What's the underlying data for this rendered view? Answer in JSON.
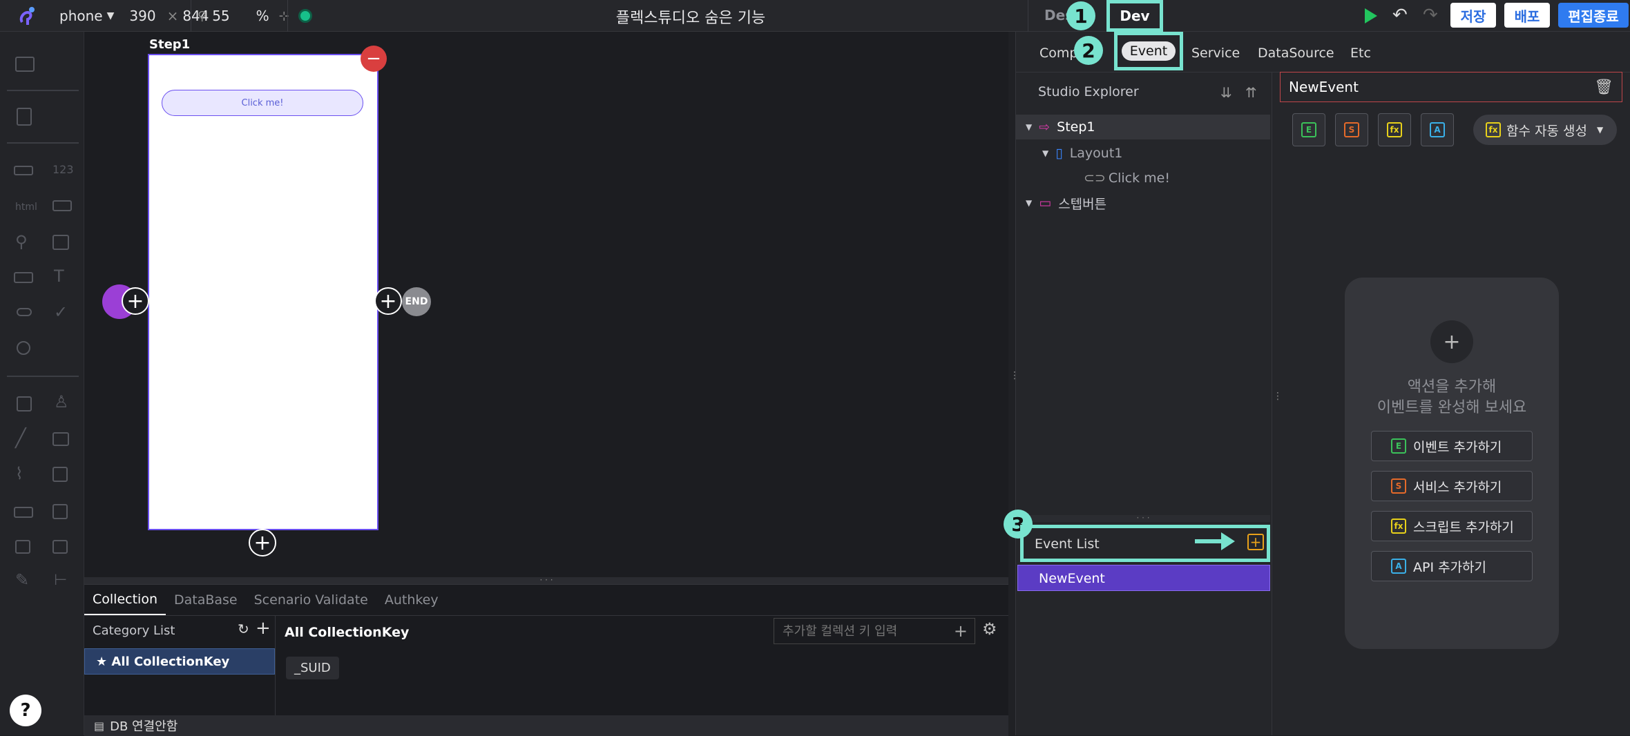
{
  "topbar": {
    "device": "phone",
    "width": "390",
    "height_prefix": "×",
    "height": "844",
    "zoom": "55",
    "zoom_unit": "%",
    "title": "플렉스튜디오 숨은 기능",
    "mode_design": "Des",
    "mode_dev": "Dev",
    "save_label": "저장",
    "deploy_label": "배포",
    "exit_label": "편집종료"
  },
  "callouts": {
    "one": "1",
    "two": "2",
    "three": "3"
  },
  "canvas": {
    "step_label": "Step1",
    "button_text": "Click me!",
    "end_label": "END",
    "minus": "−",
    "plus": "+"
  },
  "bottom": {
    "tabs": [
      "Collection",
      "DataBase",
      "Scenario Validate",
      "Authkey"
    ],
    "category_list": "Category List",
    "all_key_item": "★ All CollectionKey",
    "all_key_title": "All CollectionKey",
    "search_placeholder": "추가할 컬렉션 키 입력",
    "suid_chip": "_SUID",
    "db_status": "DB 연결안함"
  },
  "right": {
    "tabs": [
      "Comp",
      "Event",
      "Service",
      "DataSource",
      "Etc"
    ],
    "explorer_title": "Studio Explorer",
    "tree": {
      "step": "Step1",
      "layout": "Layout1",
      "button": "Click me!",
      "folder": "스텝버튼"
    },
    "event_list_title": "Event List",
    "event_item": "NewEvent",
    "event_name_value": "NewEvent",
    "tag_labels": {
      "event": "E",
      "service": "S",
      "script": "fx",
      "api": "A"
    },
    "auto_gen": "함수 자동 생성",
    "empty_line1": "액션을 추가해",
    "empty_line2": "이벤트를 완성해 보세요",
    "actions": {
      "event": "이벤트 추가하기",
      "service": "서비스 추가하기",
      "script": "스크립트 추가하기",
      "api": "API 추가하기"
    }
  },
  "help": "?"
}
